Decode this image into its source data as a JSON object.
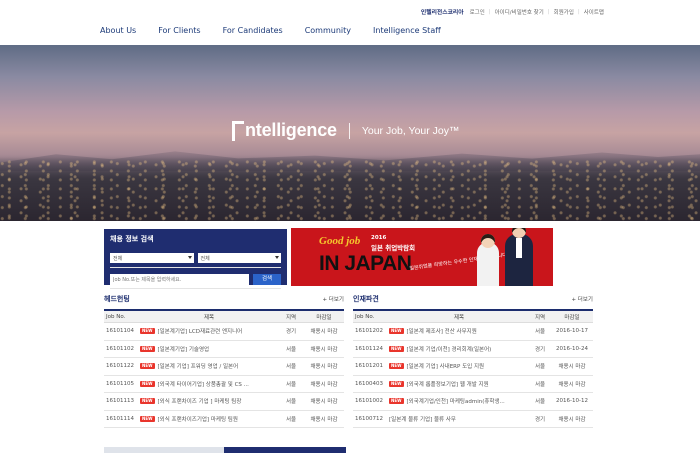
{
  "util": {
    "brand": "인텔리전스코리아",
    "links": [
      "로그인",
      "아이디/비밀번호 찾기",
      "회원가입",
      "사이트맵"
    ]
  },
  "nav": [
    "About Us",
    "For Clients",
    "For Candidates",
    "Community",
    "Intelligence Staff"
  ],
  "hero": {
    "logo": "ntelligence",
    "slogan": "Your Job, Your Joy™"
  },
  "search": {
    "title": "채용 정보 검색",
    "select1": "전체",
    "select2": "전체",
    "placeholder": "Job No.또는 제목을 입력하세요.",
    "button": "검색"
  },
  "banner": {
    "good": "Good job",
    "year": "2016",
    "fair": "일본 취업박람회",
    "headline": "IN JAPAN",
    "sub": "일본취업을 희망하는 우수한 인재를 모집합니다!"
  },
  "headhunting": {
    "title": "헤드헌팅",
    "more": "+ 더보기",
    "headers": [
      "Job No.",
      "제목",
      "지역",
      "마감일"
    ],
    "badge": "NEW",
    "rows": [
      {
        "no": "16101104",
        "title": "[일본계기업] LCD재료관련 엔지니어",
        "loc": "경기",
        "due": "채용시 마감"
      },
      {
        "no": "16101102",
        "title": "[일본계기업] 기술영업",
        "loc": "서울",
        "due": "채용시 마감"
      },
      {
        "no": "16101122",
        "title": "[일본계 기업] 프워딩 영업 / 일본어",
        "loc": "서울",
        "due": "채용시 마감"
      },
      {
        "no": "16101105",
        "title": "[외국계 타이어기업] 상품총괄 및 CS ...",
        "loc": "서울",
        "due": "채용시 마감"
      },
      {
        "no": "16101113",
        "title": "[외식 프랜차이즈 기업 ] 마케팅 팀장",
        "loc": "서울",
        "due": "채용시 마감"
      },
      {
        "no": "16101114",
        "title": "[외식 프랜차이즈기업] 마케팅 팀원",
        "loc": "서울",
        "due": "채용시 마감"
      }
    ]
  },
  "dispatch": {
    "title": "인재파견",
    "more": "+ 더보기",
    "headers": [
      "Job No.",
      "제목",
      "지역",
      "마감일"
    ],
    "badge": "NEW",
    "rows": [
      {
        "no": "16101202",
        "title": "[일본계 제조사] 전산 사무지원",
        "loc": "서울",
        "due": "2016-10-17"
      },
      {
        "no": "16101124",
        "title": "[일본계 기업/이천] 경리회계(일본어)",
        "loc": "경기",
        "due": "2016-10-24"
      },
      {
        "no": "16101201",
        "title": "[일본계 기업] 사내ERP 도입 지원",
        "loc": "서울",
        "due": "채용시 마감"
      },
      {
        "no": "16100403",
        "title": "[외국계 롭플정보기업] 웹 개발 지원",
        "loc": "서울",
        "due": "채용시 마감"
      },
      {
        "no": "16101002",
        "title": "[외국계기업/인천] 마케팅admin(휴학생...",
        "loc": "서울",
        "due": "2016-10-12"
      },
      {
        "no": "16100712",
        "title": "[일본계 물류 기업] 물류 사무",
        "loc": "경기",
        "due": "채용시 마감"
      }
    ]
  }
}
